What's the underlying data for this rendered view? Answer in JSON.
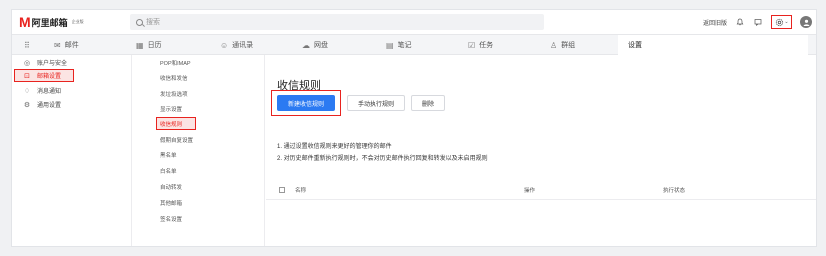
{
  "brand": {
    "mark": "M",
    "name": "阿里邮箱",
    "sub": "企业版"
  },
  "search": {
    "placeholder": "搜索"
  },
  "topright": {
    "link": "返回旧版",
    "bell": "bell-icon",
    "chat": "chat-icon",
    "gear": "gear-icon",
    "avatar": "user-avatar"
  },
  "nav": [
    {
      "label": "邮件",
      "icon": "✉"
    },
    {
      "label": "日历",
      "icon": "▦"
    },
    {
      "label": "通讯录",
      "icon": "☺"
    },
    {
      "label": "网盘",
      "icon": "☁"
    },
    {
      "label": "笔记",
      "icon": "▤"
    },
    {
      "label": "任务",
      "icon": "☑"
    },
    {
      "label": "群组",
      "icon": "♙"
    },
    {
      "label": "设置",
      "icon": ""
    }
  ],
  "sidebar": [
    {
      "label": "账户与安全",
      "icon": "◎"
    },
    {
      "label": "邮箱设置",
      "icon": "⊡"
    },
    {
      "label": "消息通知",
      "icon": "♢"
    },
    {
      "label": "通用设置",
      "icon": "⚙"
    }
  ],
  "submenu": [
    "POP和IMAP",
    "收信和发信",
    "发垃圾选项",
    "显示设置",
    "收信规则",
    "假期自复设置",
    "黑名单",
    "白名单",
    "自动转发",
    "其他邮箱",
    "签名设置"
  ],
  "main": {
    "title": "收信规则",
    "btn_new": "新建收信规则",
    "btn_manual": "手动执行规则",
    "btn_delete": "删除",
    "tip1": "1. 通过设置收信规则来更好的管理你的邮件",
    "tip2": "2. 对历史邮件重新执行规则时，不会对历史邮件执行回复和转发以及未启用规则",
    "col_name": "名称",
    "col_action": "操作",
    "col_status": "执行状态"
  }
}
